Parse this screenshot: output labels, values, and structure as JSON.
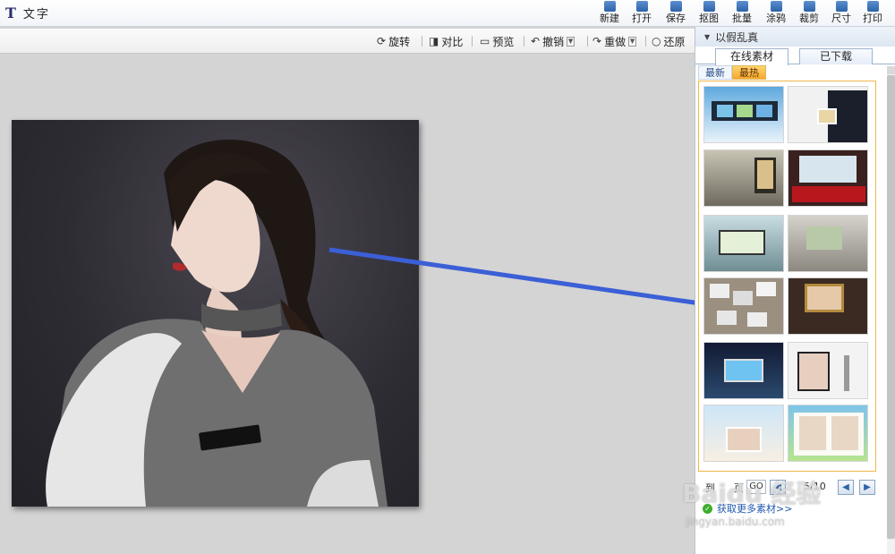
{
  "text_tool": {
    "glyph": "T",
    "label": "文字"
  },
  "top_toolbar": [
    {
      "label": "新建",
      "icon": "new-file-icon"
    },
    {
      "label": "打开",
      "icon": "open-folder-icon"
    },
    {
      "label": "保存",
      "icon": "save-icon"
    },
    {
      "label": "抠图",
      "icon": "cutout-icon"
    },
    {
      "label": "批量",
      "icon": "batch-icon"
    },
    {
      "label": "涂鸦",
      "icon": "doodle-icon"
    },
    {
      "label": "裁剪",
      "icon": "crop-icon"
    },
    {
      "label": "尺寸",
      "icon": "resize-icon"
    },
    {
      "label": "打印",
      "icon": "print-icon"
    }
  ],
  "edit_toolbar": {
    "rotate": "旋转",
    "compare": "对比",
    "preview": "预览",
    "undo": "撤销",
    "redo": "重做",
    "restore": "还原"
  },
  "right_panel": {
    "title": "以假乱真",
    "tabs": [
      {
        "label": "在线素材",
        "active": true
      },
      {
        "label": "已下载",
        "active": false
      }
    ],
    "sub_tabs": [
      {
        "label": "最新",
        "active": false
      },
      {
        "label": "最热",
        "active": true
      }
    ],
    "thumbnails": [
      {
        "name": "thumb-film-strip-city"
      },
      {
        "name": "thumb-businessman-photo-card"
      },
      {
        "name": "thumb-station-billboard"
      },
      {
        "name": "thumb-theater-screen"
      },
      {
        "name": "thumb-wall-billboard"
      },
      {
        "name": "thumb-gallery-wall"
      },
      {
        "name": "thumb-photo-collage"
      },
      {
        "name": "thumb-framed-portrait"
      },
      {
        "name": "thumb-night-street-billboard"
      },
      {
        "name": "thumb-lamp-frame"
      },
      {
        "name": "thumb-celebration-group"
      },
      {
        "name": "thumb-photo-album"
      }
    ],
    "pager": {
      "left_text": "到",
      "mid_text": "页",
      "field_value": "GO",
      "page_info": "5/10"
    },
    "more_link": "获取更多素材>>"
  },
  "watermark": {
    "brand": "Baidu 经验",
    "url": "jingyan.baidu.com"
  },
  "colors": {
    "arrow": "#3b5fd6",
    "active_tab": "#f7a92d",
    "toolbar_icon": "#2f63a8"
  }
}
